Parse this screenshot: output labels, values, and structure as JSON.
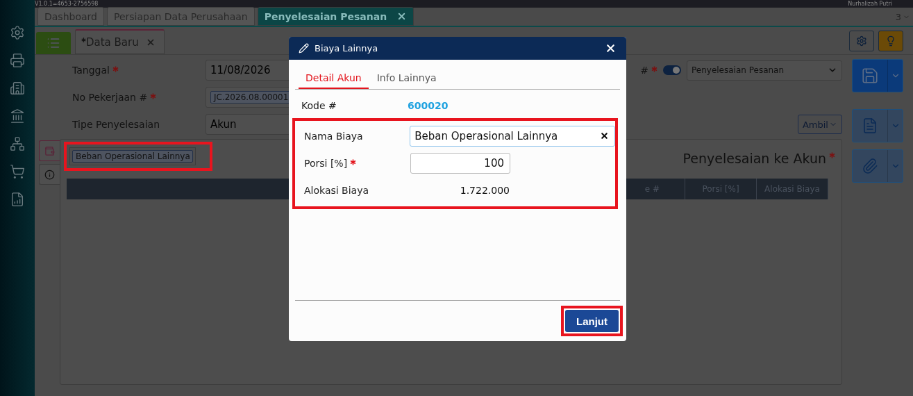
{
  "header": {
    "version": "V1.0.1=4653-2756598",
    "user": "Nurhalizah Putri"
  },
  "tabs": [
    {
      "label": "Dashboard",
      "selected": false,
      "closable": false
    },
    {
      "label": "Persiapan Data Perusahaan",
      "selected": false,
      "closable": false
    },
    {
      "label": "Penyelesaian Pesanan",
      "selected": true,
      "closable": true
    }
  ],
  "tab_count": "3",
  "document_tab": {
    "label": "Data Baru",
    "modified": true
  },
  "form": {
    "fields": [
      {
        "label": "Tanggal",
        "required": true,
        "kind": "text",
        "value": "11/08/2026"
      },
      {
        "label": "No Pekerjaan #",
        "required": true,
        "kind": "chip",
        "value": "JC.2026.08.00001"
      },
      {
        "label": "Tipe Penyelesaian",
        "required": false,
        "kind": "text",
        "value": "Akun"
      }
    ],
    "number_label": "#",
    "number_required": true,
    "auto_number": true,
    "type_select": "Penyelesaian Pesanan"
  },
  "ambil_button": "Ambil",
  "panel": {
    "title": "Penyelesaian ke Akun",
    "required": true,
    "chips": [
      "Beban Operasional Lainnya"
    ],
    "columns": [
      "e #",
      "Porsi [%]",
      "Alokasi Biaya"
    ],
    "side_tabs": [
      {
        "kind": "money",
        "selected": true
      },
      {
        "kind": "info",
        "selected": false
      }
    ]
  },
  "dialog": {
    "title": "Biaya Lainnya",
    "tabs": [
      {
        "label": "Detail Akun",
        "selected": true
      },
      {
        "label": "Info Lainnya",
        "selected": false
      }
    ],
    "code_label": "Kode #",
    "code": "600020",
    "rows": [
      {
        "label": "Nama Biaya",
        "required": false,
        "kind": "search",
        "value": "Beban Operasional Lainnya"
      },
      {
        "label": "Porsi [%]",
        "required": true,
        "kind": "number",
        "value": "100"
      },
      {
        "label": "Alokasi Biaya",
        "required": false,
        "kind": "readonly",
        "value": "1.722.000"
      }
    ],
    "button": "Lanjut"
  }
}
